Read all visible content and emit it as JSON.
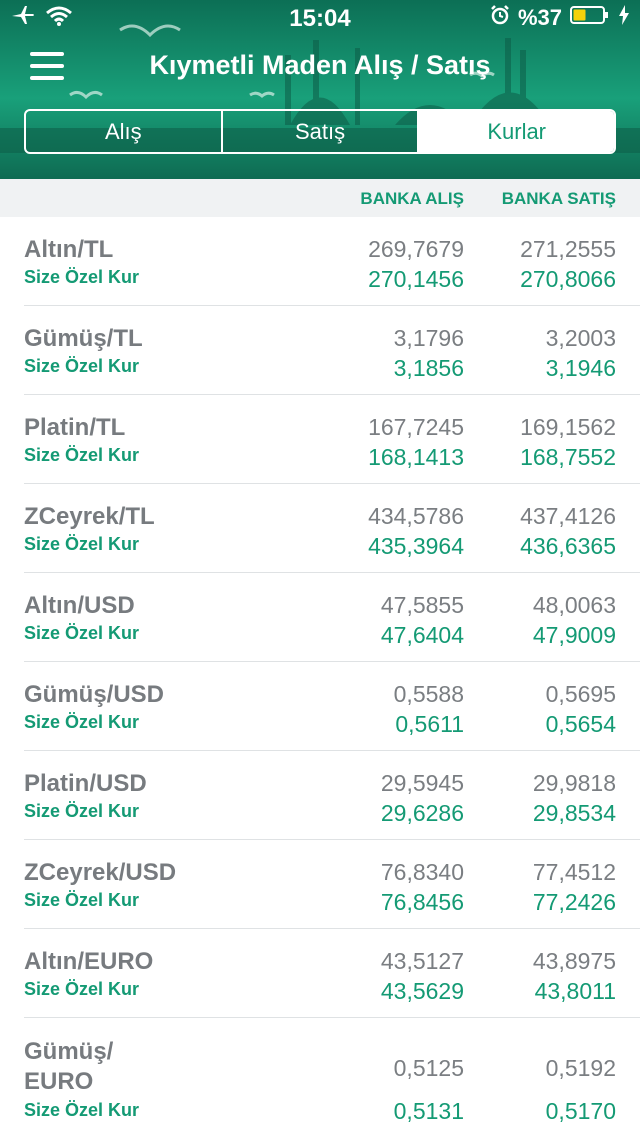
{
  "status": {
    "time": "15:04",
    "battery": "%37",
    "icons": [
      "airplane-icon",
      "wifi-icon",
      "alarm-icon",
      "battery-icon",
      "charging-icon"
    ]
  },
  "nav": {
    "title": "Kıymetli Maden Alış / Satış",
    "menu_icon": "hamburger-menu-icon"
  },
  "tabs": [
    {
      "label": "Alış",
      "active": false
    },
    {
      "label": "Satış",
      "active": false
    },
    {
      "label": "Kurlar",
      "active": true
    }
  ],
  "columns": {
    "buy": "BANKA ALIŞ",
    "sell": "BANKA SATIŞ"
  },
  "colors": {
    "accent": "#149a74",
    "header_bg": "#169a74",
    "text_gray": "#777b7f"
  },
  "rates": [
    {
      "name": "Altın/TL",
      "sub": "Size Özel Kur",
      "bank_buy": "269,7679",
      "bank_sell": "271,2555",
      "special_buy": "270,1456",
      "special_sell": "270,8066"
    },
    {
      "name": "Gümüş/TL",
      "sub": "Size Özel Kur",
      "bank_buy": "3,1796",
      "bank_sell": "3,2003",
      "special_buy": "3,1856",
      "special_sell": "3,1946"
    },
    {
      "name": "Platin/TL",
      "sub": "Size Özel Kur",
      "bank_buy": "167,7245",
      "bank_sell": "169,1562",
      "special_buy": "168,1413",
      "special_sell": "168,7552"
    },
    {
      "name": "ZCeyrek/TL",
      "sub": "Size Özel Kur",
      "bank_buy": "434,5786",
      "bank_sell": "437,4126",
      "special_buy": "435,3964",
      "special_sell": "436,6365"
    },
    {
      "name": "Altın/USD",
      "sub": "Size Özel Kur",
      "bank_buy": "47,5855",
      "bank_sell": "48,0063",
      "special_buy": "47,6404",
      "special_sell": "47,9009"
    },
    {
      "name": "Gümüş/USD",
      "sub": "Size Özel Kur",
      "bank_buy": "0,5588",
      "bank_sell": "0,5695",
      "special_buy": "0,5611",
      "special_sell": "0,5654"
    },
    {
      "name": "Platin/USD",
      "sub": "Size Özel Kur",
      "bank_buy": "29,5945",
      "bank_sell": "29,9818",
      "special_buy": "29,6286",
      "special_sell": "29,8534"
    },
    {
      "name": "ZCeyrek/USD",
      "sub": "Size Özel Kur",
      "bank_buy": "76,8340",
      "bank_sell": "77,4512",
      "special_buy": "76,8456",
      "special_sell": "77,2426"
    },
    {
      "name": "Altın/EURO",
      "sub": "Size Özel Kur",
      "bank_buy": "43,5127",
      "bank_sell": "43,8975",
      "special_buy": "43,5629",
      "special_sell": "43,8011"
    },
    {
      "name": "Gümüş/ EURO",
      "sub": "Size Özel Kur",
      "bank_buy": "0,5125",
      "bank_sell": "0,5192",
      "special_buy": "0,5131",
      "special_sell": "0,5170"
    }
  ]
}
